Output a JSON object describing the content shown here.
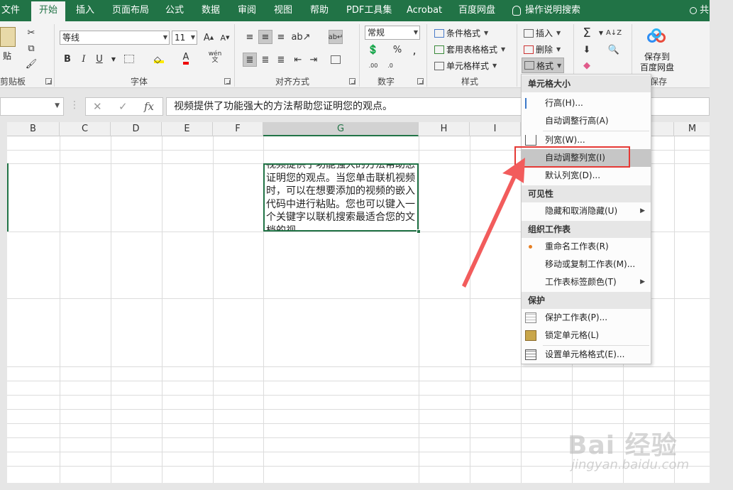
{
  "tabs": {
    "file": "文件",
    "home": "开始",
    "insert": "插入",
    "page_layout": "页面布局",
    "formulas": "公式",
    "data": "数据",
    "review": "审阅",
    "view": "视图",
    "help": "帮助",
    "pdf": "PDF工具集",
    "acrobat": "Acrobat",
    "baidu": "百度网盘",
    "tell_me": "操作说明搜索",
    "share": "共"
  },
  "ribbon": {
    "clipboard": {
      "paste_label": "贴",
      "group_label": "剪贴板"
    },
    "font": {
      "font_name": "等线",
      "font_size": "11",
      "group_label": "字体",
      "bold": "B",
      "italic": "I",
      "underline": "U",
      "wen": "wén"
    },
    "alignment": {
      "group_label": "对齐方式"
    },
    "number": {
      "format": "常规",
      "group_label": "数字",
      "percent": "%"
    },
    "styles": {
      "conditional": "条件格式",
      "table_format": "套用表格格式",
      "cell_styles": "单元格样式",
      "group_label": "样式"
    },
    "cells": {
      "insert": "插入",
      "delete": "删除",
      "format": "格式"
    },
    "editing": {
      "sigma": "Σ"
    },
    "save": {
      "line1": "保存到",
      "line2": "百度网盘",
      "group_label": "保存"
    }
  },
  "formula_bar": {
    "fx": "fx",
    "content": "视频提供了功能强大的方法帮助您证明您的观点。"
  },
  "columns": [
    "B",
    "C",
    "D",
    "E",
    "F",
    "G",
    "H",
    "I",
    "M"
  ],
  "selected_column": "G",
  "active_cell_text": "视频提供了功能强大的方法帮助您证明您的观点。当您单击联机视频时，可以在想要添加的视频的嵌入代码中进行粘贴。您也可以键入一个关键字以联机搜索最适合您的文档的视",
  "format_menu": {
    "section_size": "单元格大小",
    "row_height": "行高(H)...",
    "autofit_row": "自动调整行高(A)",
    "col_width": "列宽(W)...",
    "autofit_col": "自动调整列宽(I)",
    "default_width": "默认列宽(D)...",
    "section_visibility": "可见性",
    "hide_unhide": "隐藏和取消隐藏(U)",
    "section_organize": "组织工作表",
    "rename": "重命名工作表(R)",
    "move_copy": "移动或复制工作表(M)...",
    "tab_color": "工作表标签颜色(T)",
    "section_protect": "保护",
    "protect_sheet": "保护工作表(P)...",
    "lock_cell": "锁定单元格(L)",
    "format_cells": "设置单元格格式(E)..."
  },
  "watermark": {
    "brand": "Bai 经验",
    "url": "jingyan.baidu.com"
  },
  "colors": {
    "excel_green": "#217346",
    "highlight_red": "#e53935"
  }
}
